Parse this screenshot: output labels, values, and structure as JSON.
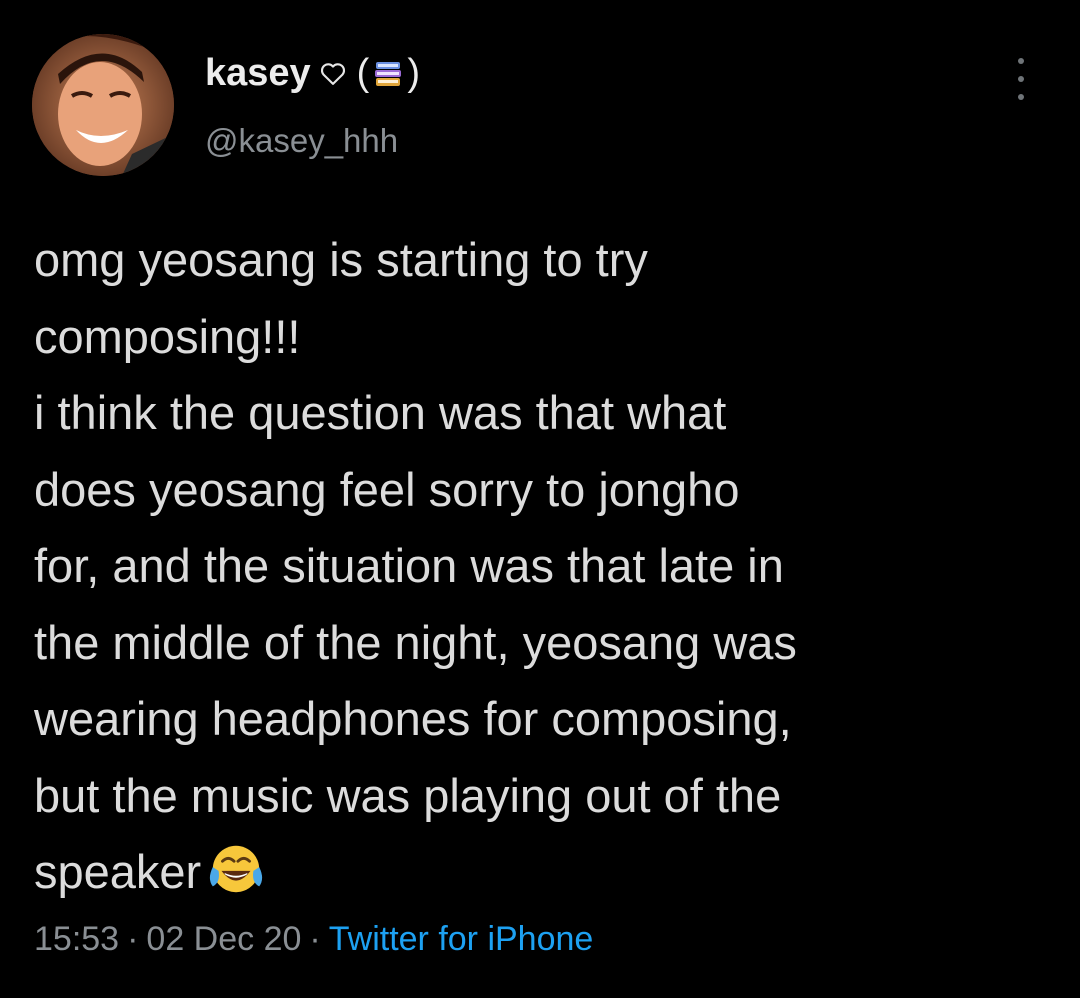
{
  "user": {
    "display_name": "kasey",
    "paren_open": "(",
    "paren_close": ")",
    "handle": "@kasey_hhh"
  },
  "tweet": {
    "text": "omg yeosang is starting to try\ncomposing!!!\ni think the question was that what\ndoes yeosang feel sorry to jongho\nfor, and the situation was that late in\nthe middle of the night, yeosang was\nwearing headphones for composing,\nbut the music was playing out of the\nspeaker",
    "emoji_icon": "face-with-tears-of-joy-icon"
  },
  "meta": {
    "time": "15:53",
    "separator": "·",
    "date": "02 Dec 20",
    "source": "Twitter for iPhone"
  },
  "colors": {
    "background": "#000000",
    "text": "#dcdcdc",
    "secondary": "#8a8f94",
    "link": "#1da1f2"
  },
  "icons": {
    "name_heart": "heart-outline-icon",
    "name_books": "books-icon",
    "more": "more-vertical-icon"
  }
}
